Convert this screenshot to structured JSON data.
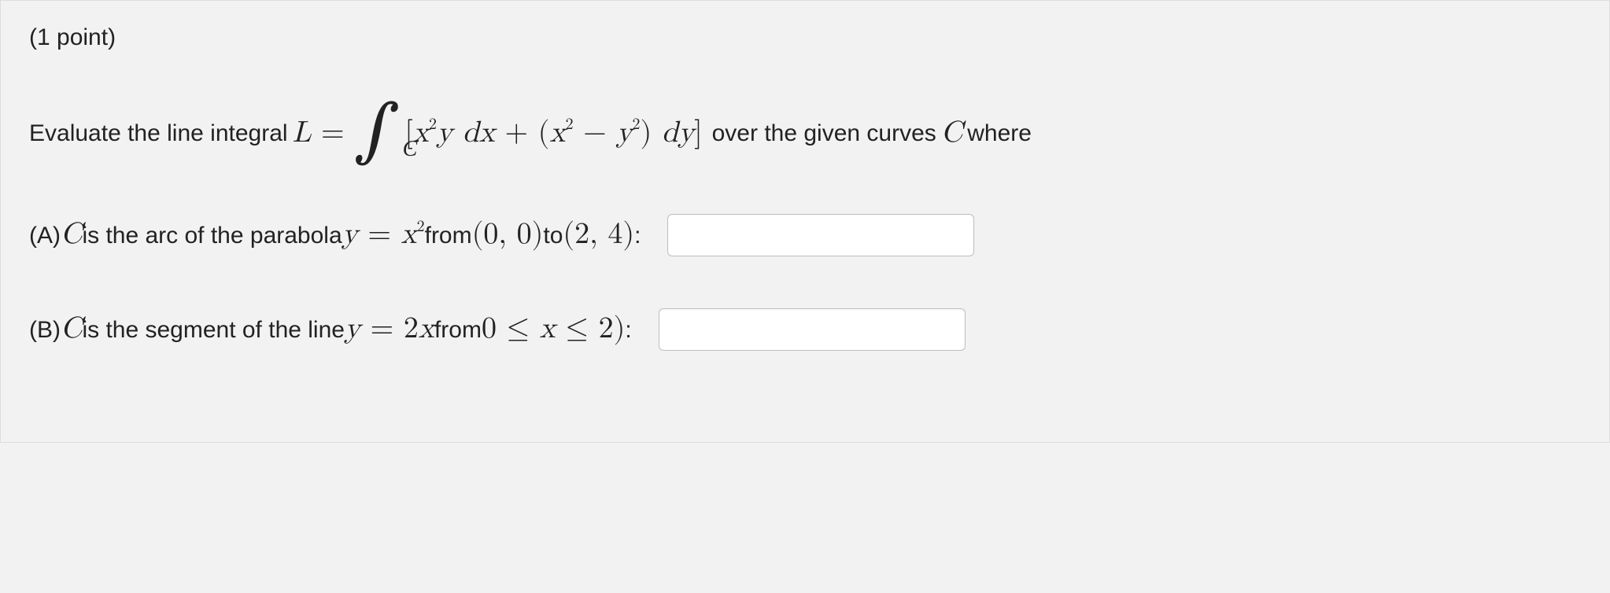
{
  "points_label": "(1 point)",
  "intro_prefix": "Evaluate the line integral ",
  "L_eq": "L",
  "equals": " = ",
  "integral_sub": "C",
  "integrand_open": "[",
  "integrand_x": "x",
  "integrand_y": "y",
  "integrand_dx": " dx",
  "integrand_plus": " + (",
  "integrand_minus": " − ",
  "integrand_close": ") ",
  "integrand_dy": "dy",
  "integrand_rb": "]",
  "intro_suffix": " over the given curves ",
  "C_var": "C",
  "where": " where",
  "part_a_prefix": "(A) ",
  "part_a_mid1": " is the arc of the parabola ",
  "part_a_y": "y",
  "part_a_eq": " = ",
  "part_a_x": "x",
  "part_a_from": " from ",
  "part_a_p0": "(0, 0)",
  "part_a_to": " to ",
  "part_a_p1": "(2, 4)",
  "part_a_colon": ":",
  "part_b_prefix": "(B) ",
  "part_b_mid1": " is the segment of the line ",
  "part_b_y": "y",
  "part_b_eq": " = ",
  "part_b_rhs": "2x",
  "part_b_from": " from ",
  "part_b_range_l": "0 ≤ ",
  "part_b_range_x": "x",
  "part_b_range_r": " ≤ 2)",
  "part_b_colon": " :",
  "input_a_value": "",
  "input_b_value": ""
}
